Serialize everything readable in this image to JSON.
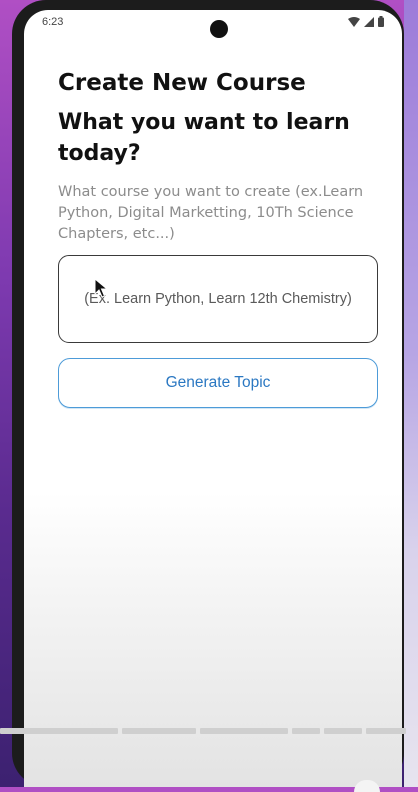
{
  "status_bar": {
    "time": "6:23",
    "icons": [
      "wifi-icon",
      "signal-icon",
      "battery-icon"
    ]
  },
  "page": {
    "title": "Create New Course",
    "subtitle": "What you want to learn today?",
    "hint": "What course you want to create (ex.Learn Python, Digital Marketting, 10Th Science Chapters, etc...)"
  },
  "course_input": {
    "value": "",
    "placeholder": "(Ex. Learn Python, Learn 12th Chemistry)"
  },
  "generate_button": {
    "label": "Generate Topic"
  },
  "colors": {
    "accent": "#2b78c2",
    "button_border": "#4d9bd8",
    "hint_text": "#8c8c8c",
    "title_text": "#111111"
  }
}
